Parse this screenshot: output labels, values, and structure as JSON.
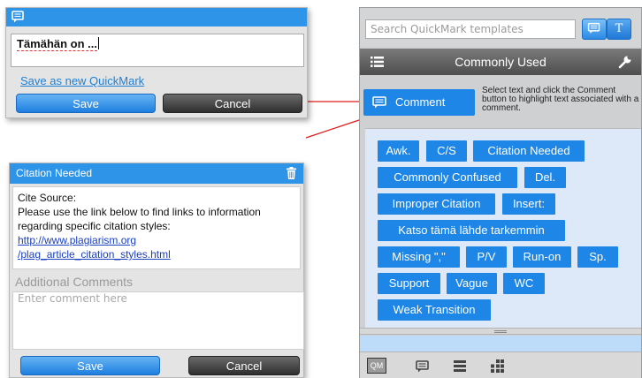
{
  "comment_popup": {
    "text": "Tämähän on ...",
    "save_as_link": "Save as new QuickMark",
    "save_label": "Save",
    "cancel_label": "Cancel"
  },
  "citation_popup": {
    "title": "Citation Needed",
    "body_line1": "Cite Source:",
    "body_line2": "Please use the link below to find links to information regarding specific citation styles:",
    "link_line1": "http://www.plagiarism.org",
    "link_line2": "/plag_article_citation_styles.html",
    "additional_label": "Additional Comments",
    "comment_placeholder": "Enter comment here",
    "save_label": "Save",
    "cancel_label": "Cancel"
  },
  "panel": {
    "search_placeholder": "Search QuickMark templates",
    "toggle_text_label": "T",
    "set_title": "Commonly Used",
    "comment_button": "Comment",
    "help_text": "Select text and click the Comment button to highlight text associated with a comment.",
    "quickmarks": [
      "Awk.",
      "C/S",
      "Citation Needed",
      "Commonly Confused",
      "Del.",
      "Improper Citation",
      "Insert:",
      "Katso tämä lähde tarkemmin",
      "Missing \",\"",
      "P/V",
      "Run-on",
      "Sp.",
      "Support",
      "Vague",
      "WC",
      "Weak Transition"
    ],
    "bottom_qm_label": "QM"
  },
  "colors": {
    "accent_blue": "#1e86e6",
    "header_dark": "#4e4e4e",
    "connector_red": "#e11b1b"
  },
  "icons": [
    "comment-icon",
    "trash-icon",
    "menu-icon",
    "wrench-icon",
    "qm-icon",
    "list-icon",
    "grid-icon"
  ]
}
